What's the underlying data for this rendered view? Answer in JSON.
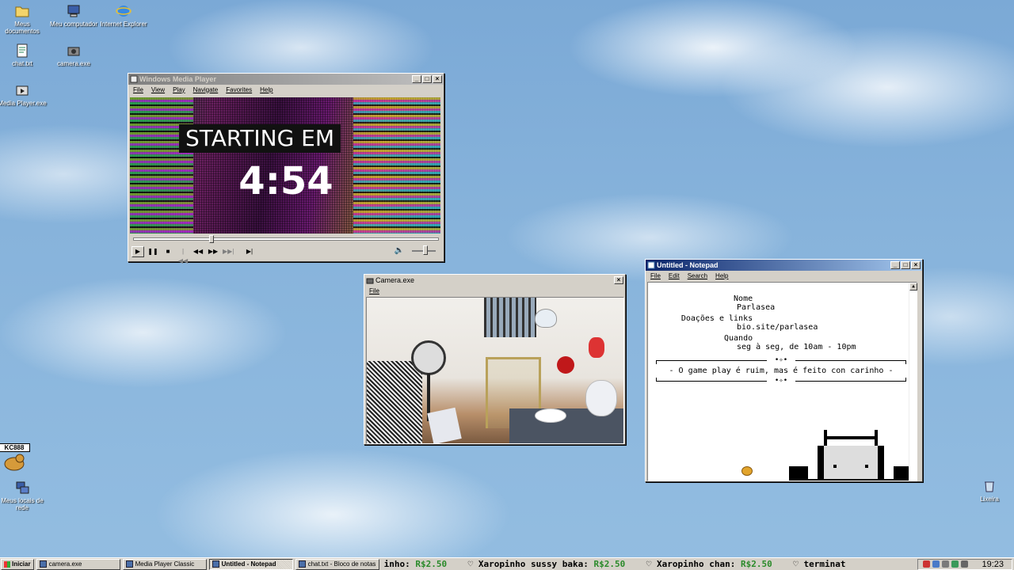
{
  "desktop": {
    "icons": [
      {
        "label": "Meus documentos"
      },
      {
        "label": "Meu computador"
      },
      {
        "label": "Internet Explorer"
      },
      {
        "label": "chat.txt"
      },
      {
        "label": "camera.exe"
      },
      {
        "label": "Media Player.exe"
      },
      {
        "label": "Meus locais de rede"
      },
      {
        "label": "Lixeira"
      }
    ],
    "sticker_text": "KC888"
  },
  "wmp": {
    "title": "Windows Media Player",
    "menu": [
      "File",
      "View",
      "Play",
      "Navigate",
      "Favorites",
      "Help"
    ],
    "video_heading": "STARTING EM",
    "countdown": "4:54",
    "seek_position": 0.25,
    "volume_level": 0.6
  },
  "camera": {
    "title": "Camera.exe",
    "menu": [
      "File"
    ]
  },
  "notepad": {
    "title": "Untitled - Notepad",
    "menu": [
      "File",
      "Edit",
      "Search",
      "Help"
    ],
    "fields": [
      {
        "key": "Nome",
        "value": "Parlasea"
      },
      {
        "key": "Doações e links",
        "value": "bio.site/parlasea"
      },
      {
        "key": "Quando",
        "value": "seg à seg, de 10am - 10pm"
      }
    ],
    "ornament": "•✧•",
    "tagline": "- O game play é ruim, mas é feito con carinho -"
  },
  "taskbar": {
    "start_label": "Iniciar",
    "tasks": [
      {
        "label": "camera.exe",
        "active": false
      },
      {
        "label": "Media Player Classic",
        "active": false
      },
      {
        "label": "Untitled - Notepad",
        "active": true
      },
      {
        "label": "chat.txt - Bloco de notas",
        "active": false
      }
    ],
    "ticker": [
      {
        "name": "inho:",
        "amount": "R$2.50"
      },
      {
        "name": "♡ Xaropinho sussy baka:",
        "amount": "R$2.50"
      },
      {
        "name": "♡ Xaropinho chan:",
        "amount": "R$2.50"
      },
      {
        "name": "♡ terminat",
        "amount": ""
      }
    ],
    "clock": "19:23",
    "colors": {
      "ticker_amount": "#2a8a2a",
      "active_title": "#0a246a"
    }
  }
}
